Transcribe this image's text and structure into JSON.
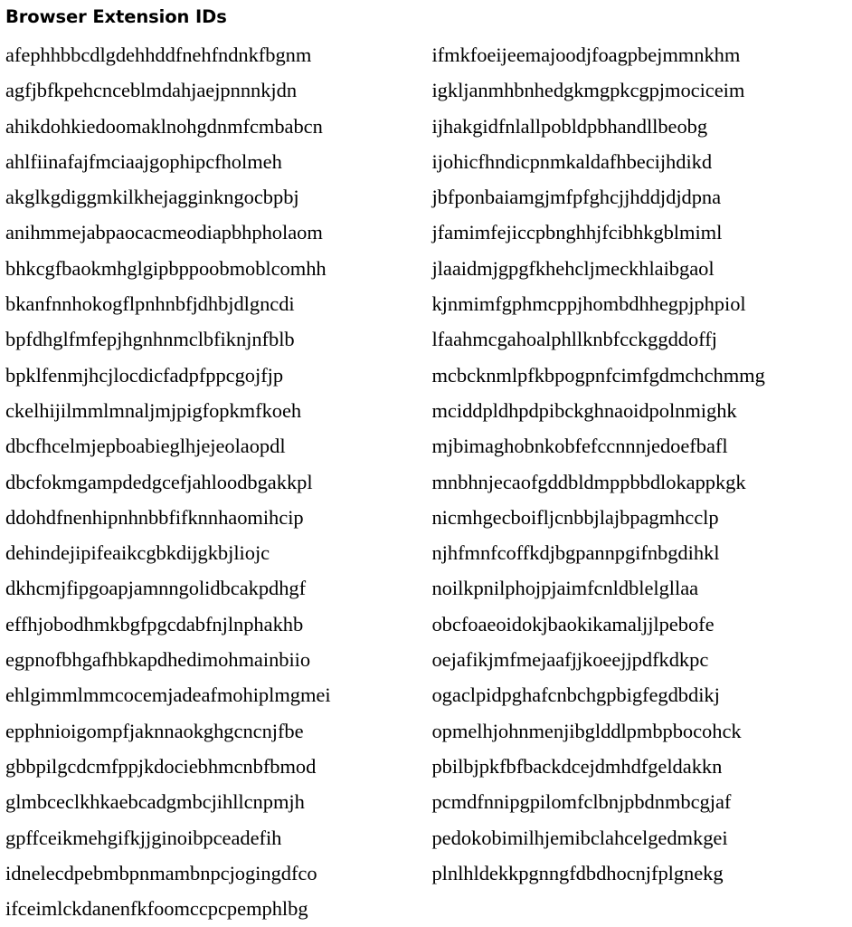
{
  "document": {
    "title": "Browser Extension IDs",
    "background_color": "#ffffff",
    "text_color": "#000000"
  },
  "columns": {
    "left": [
      "afephhbbcdlgdehhddfnehfndnkfbgnm",
      "agfjbfkpehcnceblmdahjaejpnnnkjdn",
      "ahikdohkiedoomaklnohgdnmfcmbabcn",
      "ahlfiinafajfmciaajgophipcfholmeh",
      "akglkgdiggmkilkhejagginkngocbpbj",
      "anihmmejabpaocacmeodiapbhpholaom",
      "bhkcgfbaokmhglgipbppoobmoblcomhh",
      "bkanfnnhokogflpnhnbfjdhbjdlgncdi",
      "bpfdhglfmfepjhgnhnmclbfiknjnfblb",
      "bpklfenmjhcjlocdicfadpfppcgojfjp",
      "ckelhijilmmlmnaljmjpigfopkmfkoeh",
      "dbcfhcelmjepboabieglhjejeolaopdl",
      "dbcfokmgampdedgcefjahloodbgakkpl",
      "ddohdfnenhipnhnbbfifknnhaomihcip",
      "dehindejipifeaikcgbkdijgkbjliojc",
      "dkhcmjfipgoapjamnngolidbcakpdhgf",
      "effhjobodhmkbgfpgcdabfnjlnphakhb",
      "egpnofbhgafhbkapdhedimohmainbiio",
      "ehlgimmlmmcocemjadeafmohiplmgmei",
      "epphnioigompfjaknnaokghgcncnjfbe",
      "gbbpilgcdcmfppjkdociebhmcnbfbmod",
      "glmbceclkhkaebcadgmbcjihllcnpmjh",
      "gpffceikmehgifkjjginoibpceadefih",
      "idnelecdpebmbpnmambnpcjogingdfco",
      "ifceimlckdanenfkfoomccpcpemphlbg"
    ],
    "right": [
      "ifmkfoeijeemajoodjfoagpbejmmnkhm",
      "igkljanmhbnhedgkmgpkcgpjmociceim",
      "ijhakgidfnlallpobldpbhandllbeobg",
      "ijohicfhndicpnmkaldafhbecijhdikd",
      "jbfponbaiamgjmfpfghcjjhddjdjdpna",
      "jfamimfejiccpbnghhjfcibhkgblmiml",
      "jlaaidmjgpgfkhehcljmeckhlaibgaol",
      "kjnmimfgphmcppjhombdhhegpjphpiol",
      "lfaahmcgahoalphllknbfcckggddoffj",
      "mcbcknmlpfkbpogpnfcimfgdmchchmmg",
      "mciddpldhpdpibckghnaoidpolnmighk",
      "mjbimaghobnkobfefccnnnjedoefbafl",
      "mnbhnjecaofgddbldmppbbdlokappkgk",
      "nicmhgecboifljcnbbjlajbpagmhcclp",
      "njhfmnfcoffkdjbgpannpgifnbgdihkl",
      "noilkpnilphojpjaimfcnldblelgllaa",
      "obcfoaeoidokjbaokikamaljjlpebofe",
      "oejafikjmfmejaafjjkoeejjpdfkdkpc",
      "ogaclpidpghafcnbchgpbigfegdbdikj",
      "opmelhjohnmenjibglddlpmbpbocohck",
      "pbilbjpkfbfbackdcejdmhdfgeldakkn",
      "pcmdfnnipgpilomfclbnjpbdnmbcgjaf",
      "pedokobimilhjemibclahcelgedmkgei",
      "plnlhldekkpgnngfdbdhocnjfplgnekg"
    ]
  }
}
